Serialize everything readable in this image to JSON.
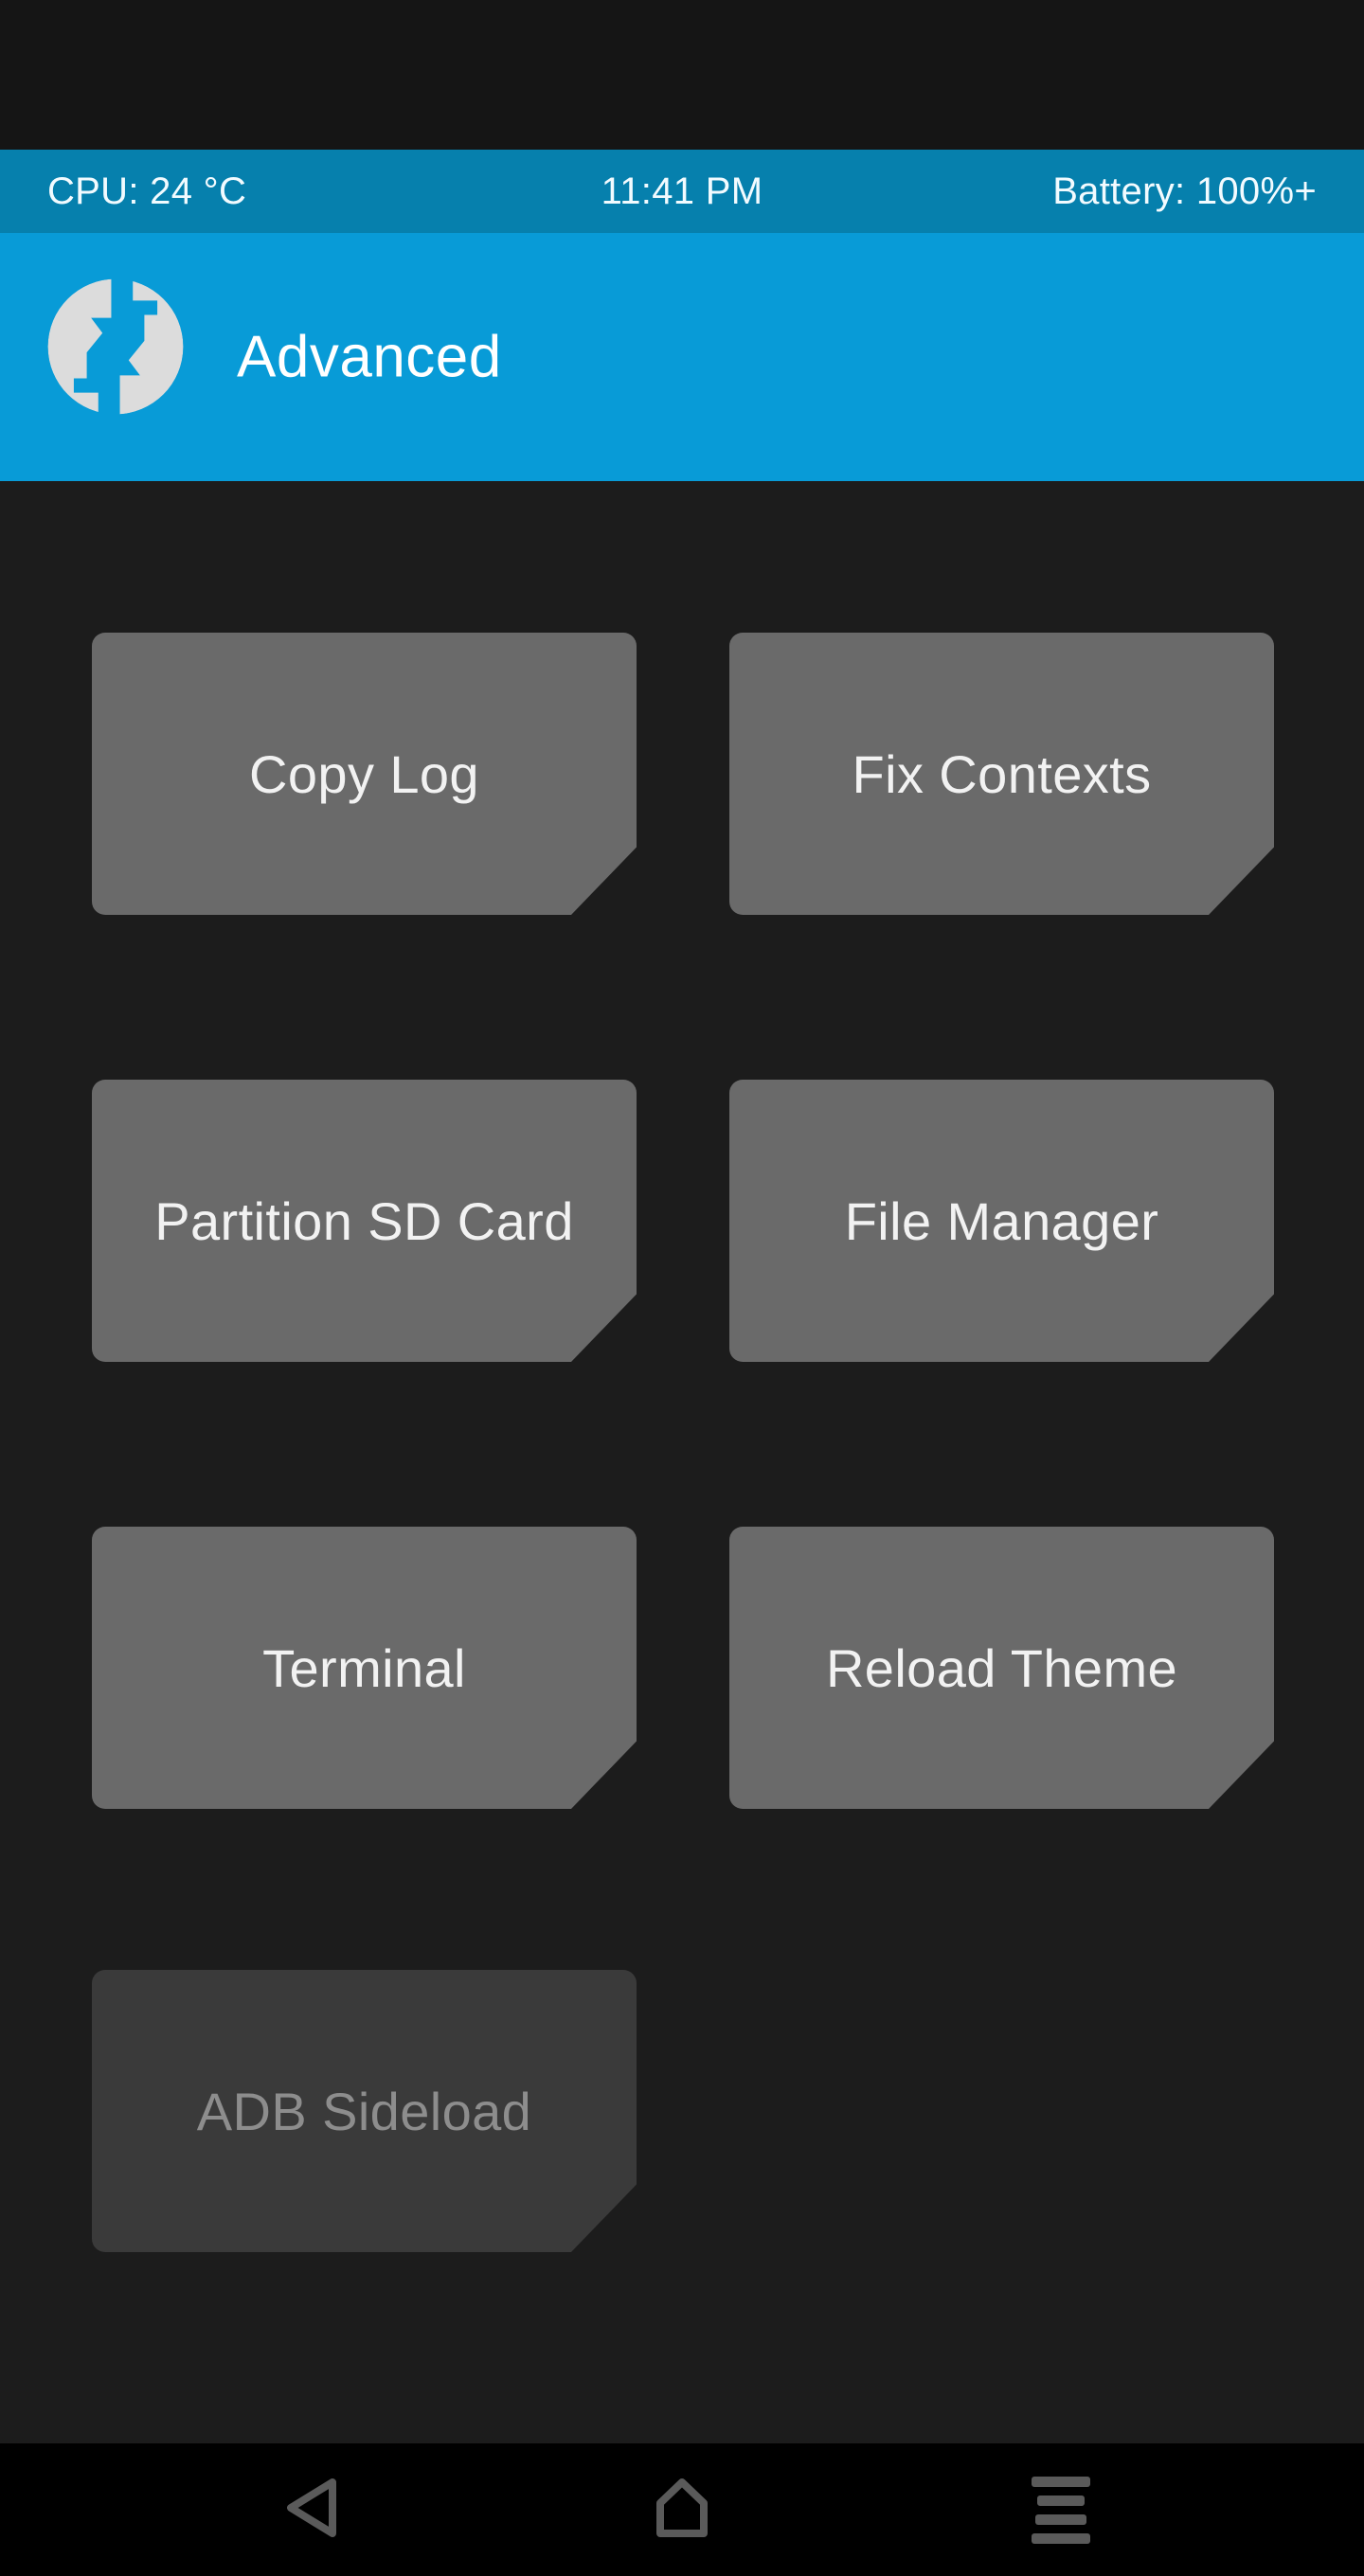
{
  "statusbar": {
    "cpu": "CPU: 24 °C",
    "time": "11:41 PM",
    "battery": "Battery: 100%+"
  },
  "header": {
    "title": "Advanced",
    "logo_icon": "twrp-logo-icon",
    "background_color": "#089bd7"
  },
  "theme": {
    "accent_color": "#089bd7",
    "statusbar_color": "#0680ad",
    "content_background": "#1c1c1c",
    "button_color": "#6a6a6a",
    "button_disabled_color": "#3a3a3a",
    "button_text_color": "#f2f2f2",
    "button_disabled_text_color": "#8d8d8d"
  },
  "buttons": [
    {
      "label": "Copy Log",
      "enabled": true
    },
    {
      "label": "Fix Contexts",
      "enabled": true
    },
    {
      "label": "Partition SD Card",
      "enabled": true
    },
    {
      "label": "File Manager",
      "enabled": true
    },
    {
      "label": "Terminal",
      "enabled": true
    },
    {
      "label": "Reload Theme",
      "enabled": true
    },
    {
      "label": "ADB Sideload",
      "enabled": false
    }
  ],
  "navbar": {
    "back_icon": "back-triangle-icon",
    "home_icon": "home-icon",
    "menu_icon": "menu-icon"
  }
}
